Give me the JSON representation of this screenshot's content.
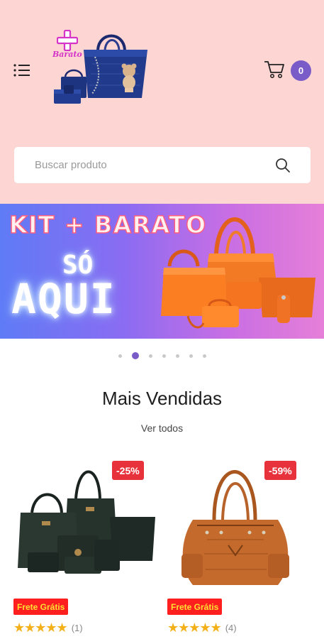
{
  "header": {
    "logo_text": "Barato",
    "cart_count": "0"
  },
  "search": {
    "placeholder": "Buscar produto"
  },
  "banner": {
    "title": "KIT + BARATO",
    "line1": "SÓ",
    "line2": "AQUI"
  },
  "carousel": {
    "total": 7,
    "active_index": 1
  },
  "section": {
    "title": "Mais Vendidas",
    "see_all": "Ver todos"
  },
  "products": [
    {
      "discount": "-25%",
      "shipping": "Frete Grátis",
      "stars": "★★★★★",
      "reviews": "(1)",
      "color": "#1f2a25"
    },
    {
      "discount": "-59%",
      "shipping": "Frete Grátis",
      "stars": "★★★★★",
      "reviews": "(4)",
      "color": "#c26a2e"
    }
  ],
  "colors": {
    "header_bg": "#fdd6d3",
    "accent": "#7a5cc9",
    "discount_bg": "#e8323b",
    "shipping_bg": "#ff1f1f",
    "shipping_text": "#ffe033",
    "star": "#f3b019"
  }
}
